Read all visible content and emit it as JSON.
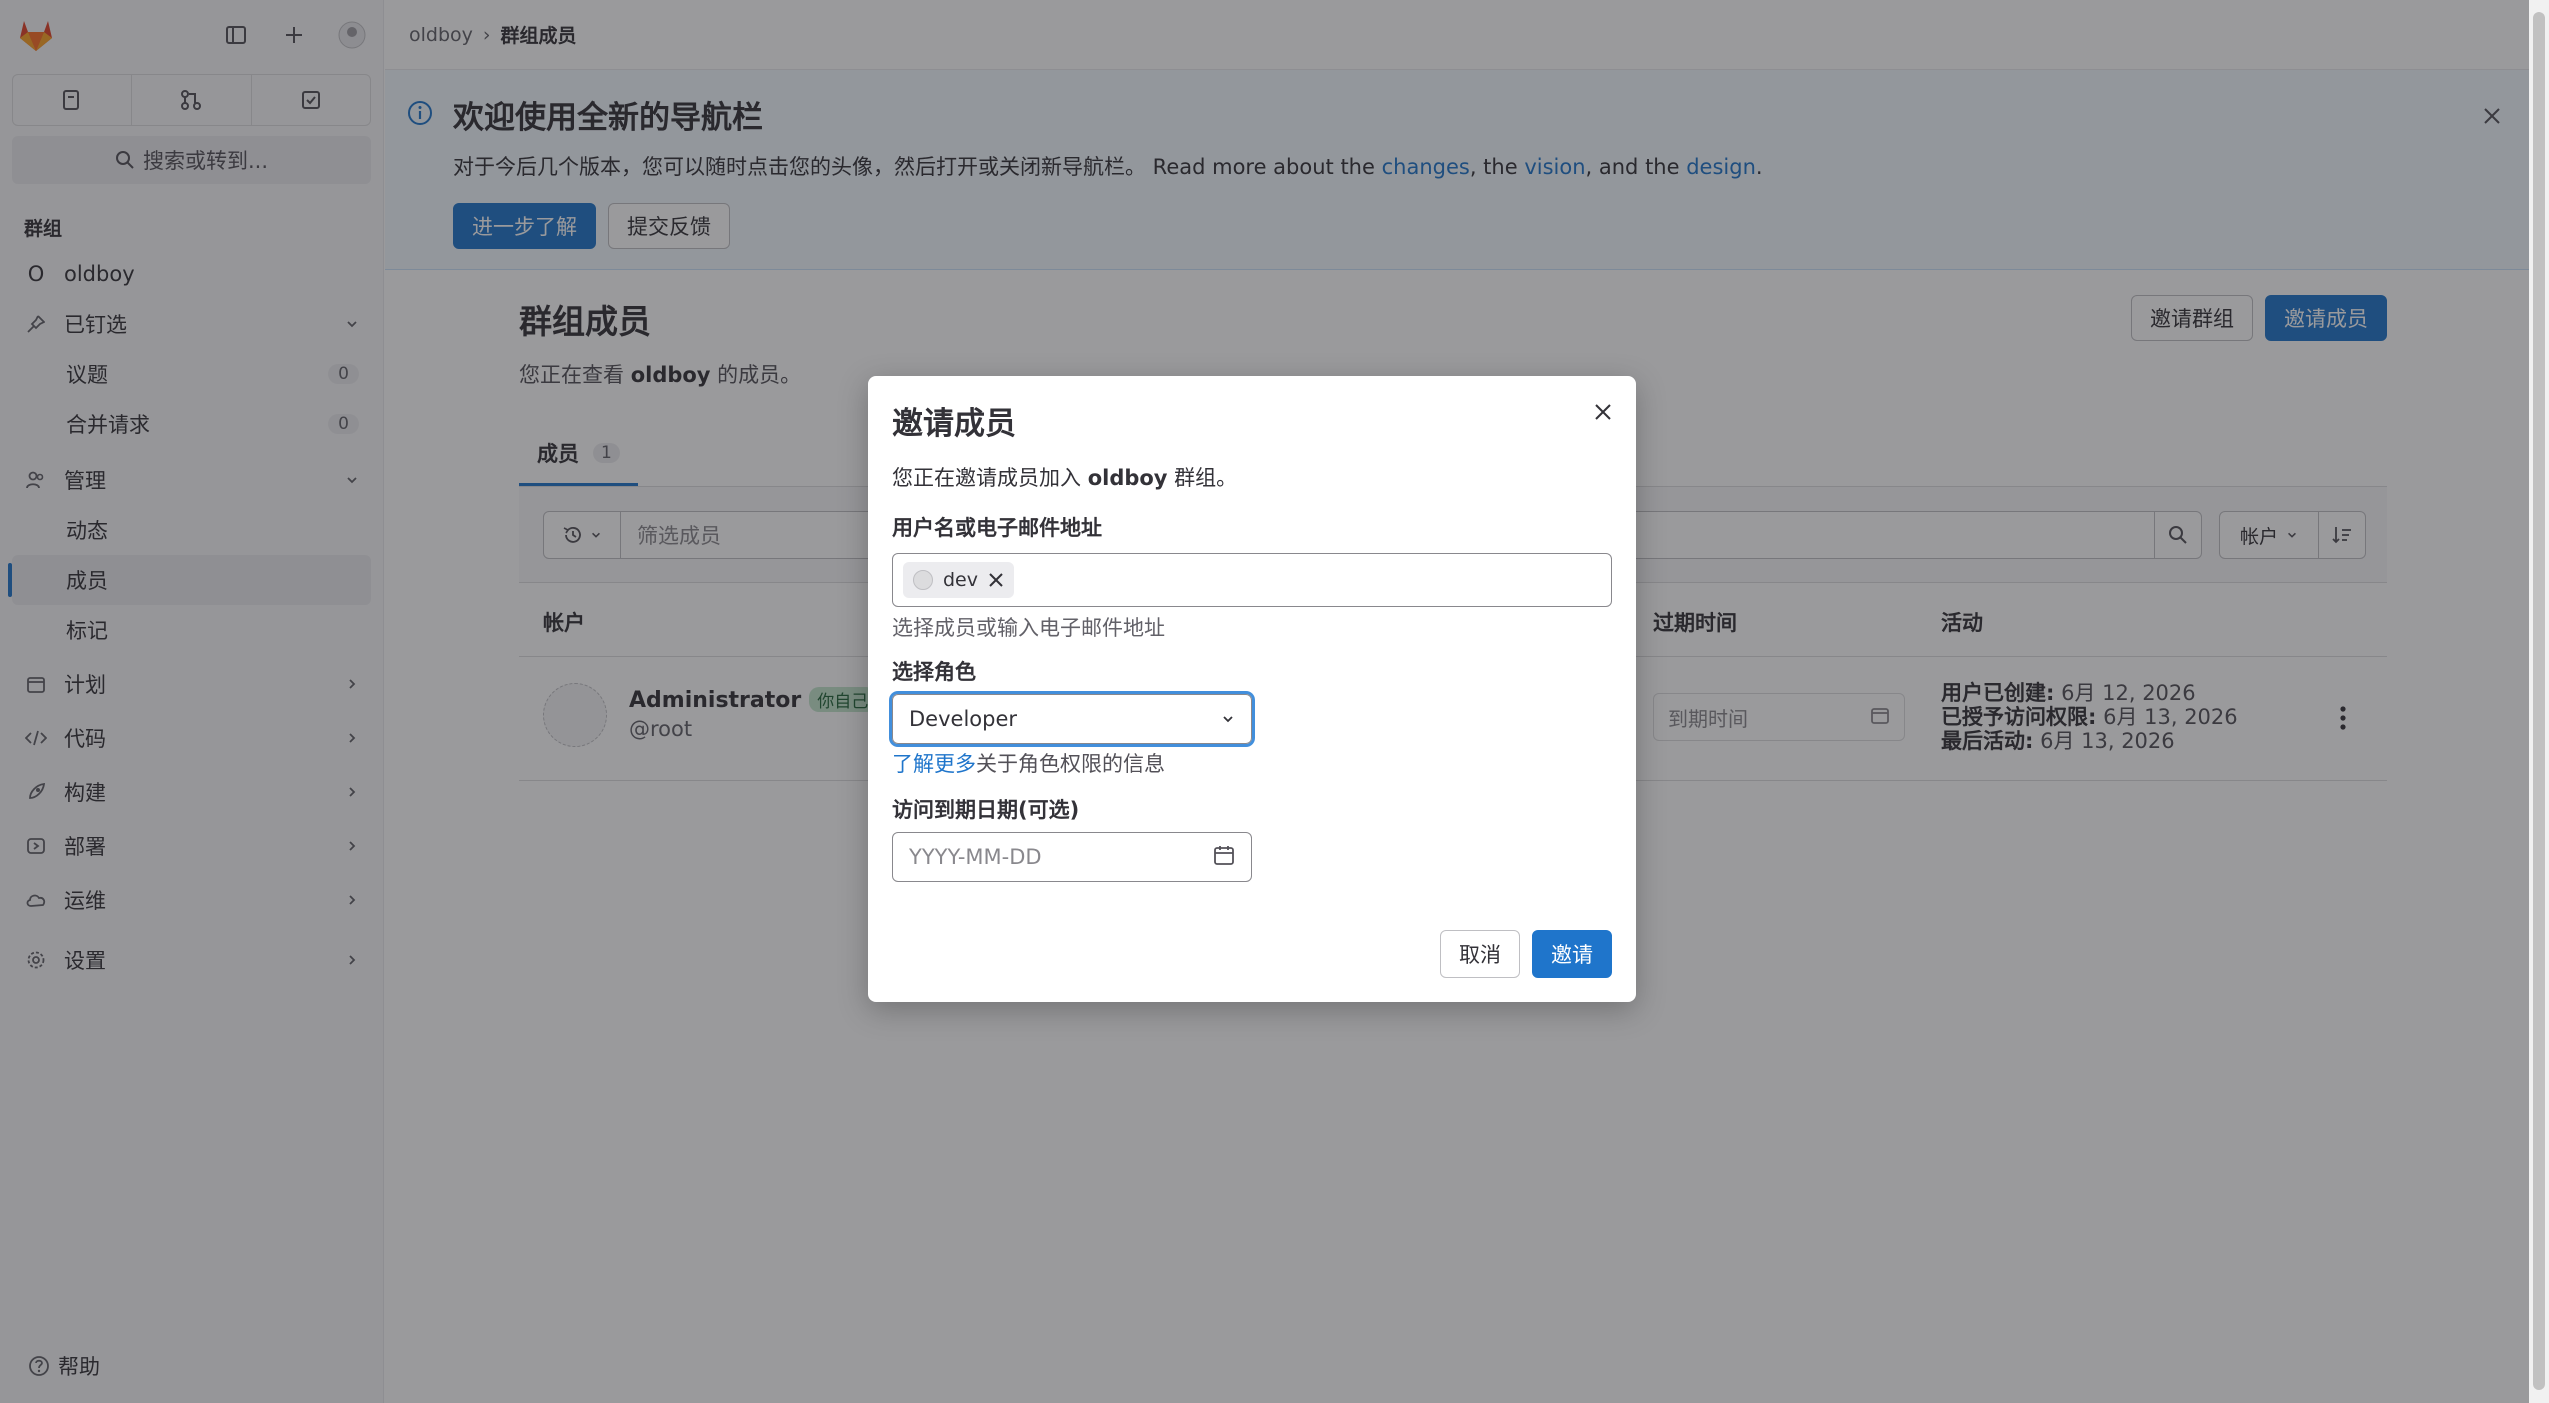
{
  "breadcrumb": {
    "group": "oldboy",
    "current": "群组成员"
  },
  "sidebar": {
    "search_label": "搜索或转到...",
    "section_title": "群组",
    "group_initial": "O",
    "group_name": "oldboy",
    "pinned": {
      "label": "已钉选",
      "items": [
        {
          "label": "议题",
          "count": "0"
        },
        {
          "label": "合并请求",
          "count": "0"
        }
      ]
    },
    "manage": {
      "label": "管理",
      "items": [
        {
          "label": "动态"
        },
        {
          "label": "成员"
        },
        {
          "label": "标记"
        }
      ]
    },
    "nav": [
      {
        "label": "计划"
      },
      {
        "label": "代码"
      },
      {
        "label": "构建"
      },
      {
        "label": "部署"
      },
      {
        "label": "运维"
      },
      {
        "label": "设置"
      }
    ],
    "help": "帮助"
  },
  "banner": {
    "title": "欢迎使用全新的导航栏",
    "text_prefix": "对于今后几个版本，您可以随时点击您的头像，然后打开或关闭新导航栏。 Read more about the ",
    "link_changes": "changes",
    "text_mid1": ", the ",
    "link_vision": "vision",
    "text_mid2": ", and the ",
    "link_design": "design",
    "text_suffix": ".",
    "learn_more": "进一步了解",
    "feedback": "提交反馈"
  },
  "page": {
    "title": "群组成员",
    "sub_prefix": "您正在查看 ",
    "sub_group": "oldboy",
    "sub_suffix": " 的成员。",
    "invite_group": "邀请群组",
    "invite_members": "邀请成员",
    "tab_label": "成员",
    "tab_count": "1",
    "filter_placeholder": "筛选成员",
    "sort_label": "帐户",
    "columns": {
      "account": "帐户",
      "expiration": "过期时间",
      "activity": "活动"
    },
    "member": {
      "name": "Administrator",
      "badge": "你自己",
      "username": "@root",
      "expiration_placeholder": "到期时间",
      "created_label": "用户已创建:",
      "created_value": " 6月 12, 2026",
      "granted_label": "已授予访问权限:",
      "granted_value": " 6月 13, 2026",
      "last_label": "最后活动:",
      "last_value": " 6月 13, 2026"
    }
  },
  "modal": {
    "title": "邀请成员",
    "intro_prefix": "您正在邀请成员加入 ",
    "intro_group": "oldboy",
    "intro_suffix": " 群组。",
    "user_label": "用户名或电子邮件地址",
    "token": "dev",
    "user_hint": "选择成员或输入电子邮件地址",
    "role_label": "选择角色",
    "role_value": "Developer",
    "learn_link": "了解更多",
    "learn_suffix": "关于角色权限的信息",
    "date_label": "访问到期日期(可选)",
    "date_placeholder": "YYYY-MM-DD",
    "cancel": "取消",
    "invite": "邀请"
  },
  "colors": {
    "primary": "#1f75cb",
    "banner_bg": "#f2f9ff",
    "sidebar_bg": "#f8f8f9",
    "overlay": "rgba(31,30,36,0.45)",
    "logo": "#e24329"
  }
}
